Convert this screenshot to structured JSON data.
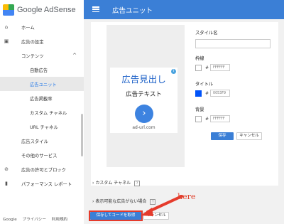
{
  "brand": {
    "name": "Google AdSense"
  },
  "sidebar": {
    "items": [
      {
        "label": "ホーム",
        "icon": "home-icon",
        "glyph": "⌂",
        "level": 0
      },
      {
        "label": "広告の設定",
        "icon": "ad-settings-icon",
        "glyph": "▣",
        "level": 0
      },
      {
        "label": "コンテンツ",
        "icon": "",
        "glyph": "",
        "level": 0,
        "expanded": true,
        "chevron": "^"
      },
      {
        "label": "自動広告",
        "level": 1
      },
      {
        "label": "広告ユニット",
        "level": 1,
        "active": true
      },
      {
        "label": "広告掲載率",
        "level": 1
      },
      {
        "label": "カスタム チャネル",
        "level": 1
      },
      {
        "label": "URL チャネル",
        "level": 1
      },
      {
        "label": "広告スタイル",
        "level": 0
      },
      {
        "label": "その他のサービス",
        "level": 0
      },
      {
        "label": "広告の許可とブロック",
        "icon": "block-icon",
        "glyph": "⊘",
        "level": 0
      },
      {
        "label": "パフォーマンス レポート",
        "icon": "bar-chart-icon",
        "glyph": "▮",
        "level": 0
      }
    ],
    "footer": {
      "google": "Google",
      "privacy": "プライバシー",
      "terms": "利用規約"
    }
  },
  "topbar": {
    "title": "広告ユニット",
    "menu_icon": "hamburger-menu-icon"
  },
  "preview": {
    "headline": "広告見出し",
    "text": "広告テキスト",
    "url": "ad-url.com",
    "info_glyph": "i",
    "go_glyph": "›"
  },
  "settings": {
    "style_name_label": "スタイル名",
    "style_name_value": "",
    "border": {
      "label": "枠線",
      "hex": "FFFFFF",
      "swatch": "#ffffff"
    },
    "title": {
      "label": "タイトル",
      "hex": "0053F9",
      "swatch": "#0053f9"
    },
    "background": {
      "label": "背景",
      "hex": "FFFFFF",
      "swatch": "#ffffff"
    },
    "hash": "#",
    "save_label": "保存",
    "cancel_label": "キャンセル"
  },
  "sections": {
    "custom_channel": "カスタム チャネル",
    "unfilled": "表示可能な広告がない場合",
    "help_glyph": "?",
    "expand_glyph": "›"
  },
  "footer_actions": {
    "save_get_code": "保存してコードを取得",
    "cancel": "キャンセル"
  },
  "annotation": {
    "text": "here",
    "color": "#e0412c"
  },
  "colors": {
    "accent": "#3b7fd6",
    "annotation_red": "#e53b2c"
  }
}
